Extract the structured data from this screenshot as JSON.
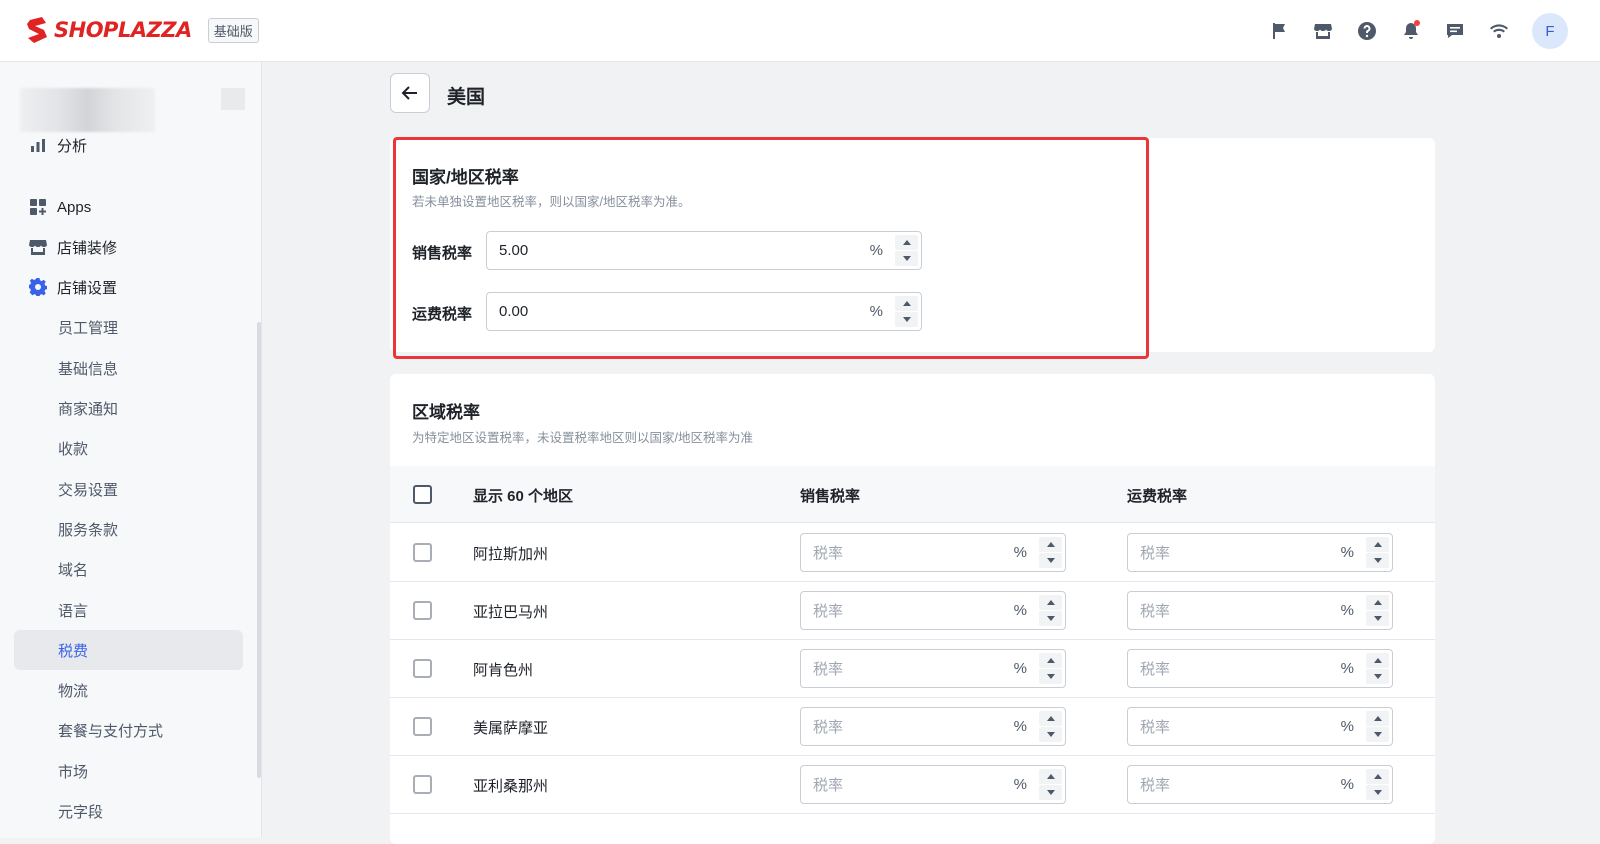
{
  "brand": {
    "name": "SHOPLAZZA",
    "plan_badge": "基础版",
    "logo_color": "#e02424"
  },
  "header": {
    "icons": [
      "flag-icon",
      "store-icon",
      "help-icon",
      "bell-icon",
      "chat-icon",
      "wifi-icon"
    ],
    "avatar_initial": "F"
  },
  "sidebar": {
    "items": [
      {
        "label": "分析",
        "icon": "bar-chart-icon"
      },
      {
        "label": "Apps",
        "icon": "apps-icon"
      },
      {
        "label": "店铺装修",
        "icon": "storefront-icon"
      },
      {
        "label": "店铺设置",
        "icon": "gear-icon",
        "accent": "#3a62e8"
      }
    ],
    "sub_items": [
      {
        "label": "员工管理"
      },
      {
        "label": "基础信息"
      },
      {
        "label": "商家通知"
      },
      {
        "label": "收款"
      },
      {
        "label": "交易设置"
      },
      {
        "label": "服务条款"
      },
      {
        "label": "域名"
      },
      {
        "label": "语言"
      },
      {
        "label": "税费",
        "active": true
      },
      {
        "label": "物流"
      },
      {
        "label": "套餐与支付方式"
      },
      {
        "label": "市场"
      },
      {
        "label": "元字段"
      }
    ]
  },
  "page": {
    "title": "美国"
  },
  "country_tax": {
    "title": "国家/地区税率",
    "description": "若未单独设置地区税率，则以国家/地区税率为准。",
    "sales_label": "销售税率",
    "sales_value": "5.00",
    "shipping_label": "运费税率",
    "shipping_value": "0.00",
    "unit": "%",
    "highlight_color": "#e8363a"
  },
  "region_tax": {
    "title": "区域税率",
    "description": "为特定地区设置税率，未设置税率地区则以国家/地区税率为准",
    "columns": [
      "显示 60 个地区",
      "销售税率",
      "运费税率"
    ],
    "placeholder": "税率",
    "unit": "%",
    "rows": [
      {
        "name": "阿拉斯加州"
      },
      {
        "name": "亚拉巴马州"
      },
      {
        "name": "阿肯色州"
      },
      {
        "name": "美属萨摩亚"
      },
      {
        "name": "亚利桑那州"
      }
    ]
  }
}
